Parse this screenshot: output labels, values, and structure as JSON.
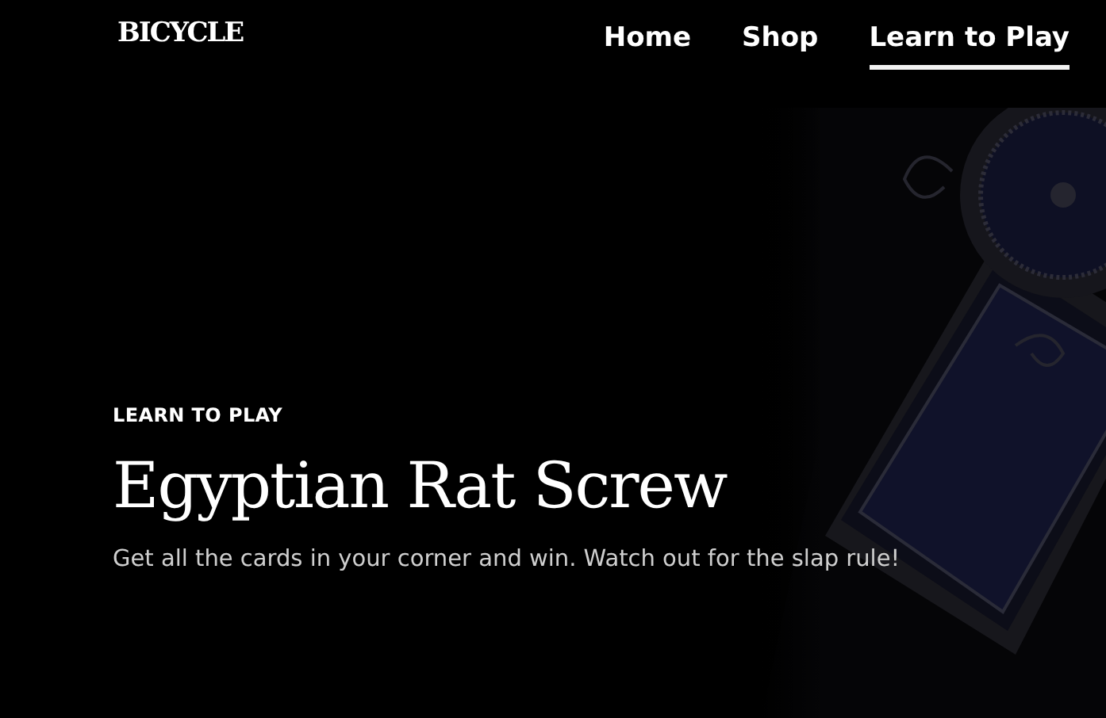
{
  "logo": {
    "text": "BICYCLE"
  },
  "nav": [
    {
      "label": "Home",
      "selected": false
    },
    {
      "label": "Shop",
      "selected": false
    },
    {
      "label": "Learn to Play",
      "selected": true
    }
  ],
  "hero": {
    "eyebrow": "LEARN TO PLAY",
    "title": "Egyptian Rat Screw",
    "subtitle": "Get all the cards in your corner and win. Watch out for the slap rule!"
  }
}
